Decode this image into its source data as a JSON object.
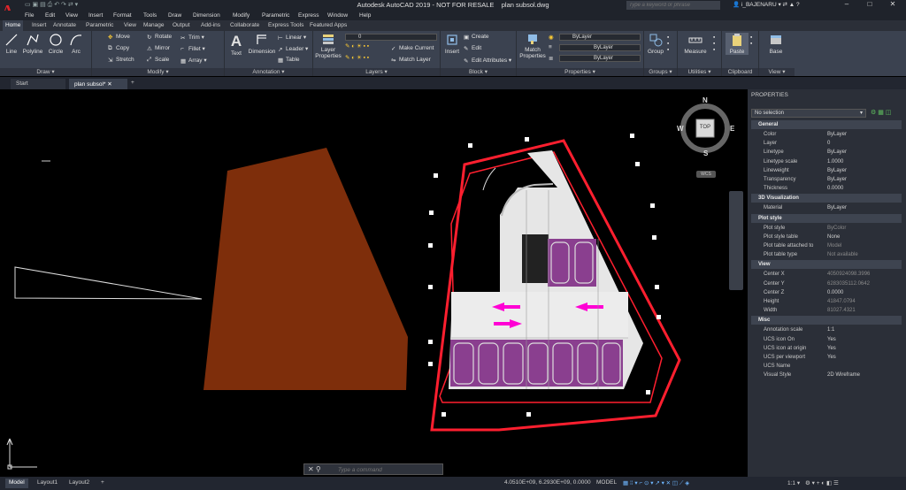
{
  "app": {
    "title": "Autodesk AutoCAD 2019 - NOT FOR RESALE",
    "file": "plan subsol.dwg",
    "search_placeholder": "Type a keyword or phrase",
    "user": "i_BAJENARU",
    "logo": "A"
  },
  "menu": [
    "File",
    "Edit",
    "View",
    "Insert",
    "Format",
    "Tools",
    "Draw",
    "Dimension",
    "Modify",
    "Parametric",
    "Express",
    "Window",
    "Help"
  ],
  "ribbon_tabs": [
    "Home",
    "Insert",
    "Annotate",
    "Parametric",
    "View",
    "Manage",
    "Output",
    "Add-ins",
    "Collaborate",
    "Express Tools",
    "Featured Apps"
  ],
  "ribbon": {
    "draw": {
      "title": "Draw",
      "items": [
        "Line",
        "Polyline",
        "Circle",
        "Arc"
      ]
    },
    "modify": {
      "title": "Modify",
      "items": [
        "Move",
        "Rotate",
        "Trim",
        "Copy",
        "Mirror",
        "Fillet",
        "Stretch",
        "Scale",
        "Array"
      ]
    },
    "annotation": {
      "title": "Annotation",
      "text": "Text",
      "dimension": "Dimension",
      "linear": "Linear",
      "leader": "Leader",
      "table": "Table"
    },
    "layers": {
      "title": "Layers",
      "layer_properties": "Layer Properties",
      "current": "0",
      "make_current": "Make Current",
      "match_layer": "Match Layer"
    },
    "block": {
      "title": "Block",
      "insert": "Insert",
      "create": "Create",
      "edit": "Edit",
      "edit_attributes": "Edit Attributes"
    },
    "properties": {
      "title": "Properties",
      "match": "Match Properties",
      "color": "ByLayer",
      "linetype": "ByLayer",
      "lineweight": "ByLayer"
    },
    "groups": {
      "title": "Groups",
      "group": "Group"
    },
    "utilities": {
      "title": "Utilities",
      "measure": "Measure"
    },
    "clipboard": {
      "title": "Clipboard",
      "paste": "Paste"
    },
    "view": {
      "title": "View",
      "base": "Base"
    }
  },
  "doc_tabs": [
    "Start",
    "plan subsol*"
  ],
  "viewcube": {
    "top": "TOP",
    "n": "N",
    "s": "S",
    "e": "E",
    "w": "W",
    "wcs": "WCS"
  },
  "command_placeholder": "Type a command",
  "properties": {
    "header": "PROPERTIES",
    "selection": "No selection",
    "sections": [
      {
        "name": "General",
        "rows": [
          [
            "Color",
            "ByLayer"
          ],
          [
            "Layer",
            "0"
          ],
          [
            "Linetype",
            "ByLayer"
          ],
          [
            "Linetype scale",
            "1.0000"
          ],
          [
            "Lineweight",
            "ByLayer"
          ],
          [
            "Transparency",
            "ByLayer"
          ],
          [
            "Thickness",
            "0.0000"
          ]
        ]
      },
      {
        "name": "3D Visualization",
        "rows": [
          [
            "Material",
            "ByLayer"
          ]
        ]
      },
      {
        "name": "Plot style",
        "rows": [
          [
            "Plot style",
            "ByColor"
          ],
          [
            "Plot style table",
            "None"
          ],
          [
            "Plot table attached to",
            "Model"
          ],
          [
            "Plot table type",
            "Not available"
          ]
        ]
      },
      {
        "name": "View",
        "rows": [
          [
            "Center X",
            "4050924098.3996"
          ],
          [
            "Center Y",
            "6283035112.0642"
          ],
          [
            "Center Z",
            "0.0000"
          ],
          [
            "Height",
            "41847.0794"
          ],
          [
            "Width",
            "81027.4321"
          ]
        ]
      },
      {
        "name": "Misc",
        "rows": [
          [
            "Annotation scale",
            "1:1"
          ],
          [
            "UCS icon On",
            "Yes"
          ],
          [
            "UCS icon at origin",
            "Yes"
          ],
          [
            "UCS per viewport",
            "Yes"
          ],
          [
            "UCS Name",
            ""
          ],
          [
            "Visual Style",
            "2D Wireframe"
          ]
        ]
      }
    ]
  },
  "status": {
    "tabs": [
      "Model",
      "Layout1",
      "Layout2"
    ],
    "coords": "4.0510E+09, 6.2930E+09, 0.0000",
    "space": "MODEL",
    "scale": "1:1"
  },
  "colors": {
    "accent": "#e0242a",
    "ribbon": "#3b4250",
    "parking": "#8a3f8f",
    "arrow": "#ff00d4",
    "wall": "#ff1f2f",
    "brown": "#7e2e0b"
  }
}
